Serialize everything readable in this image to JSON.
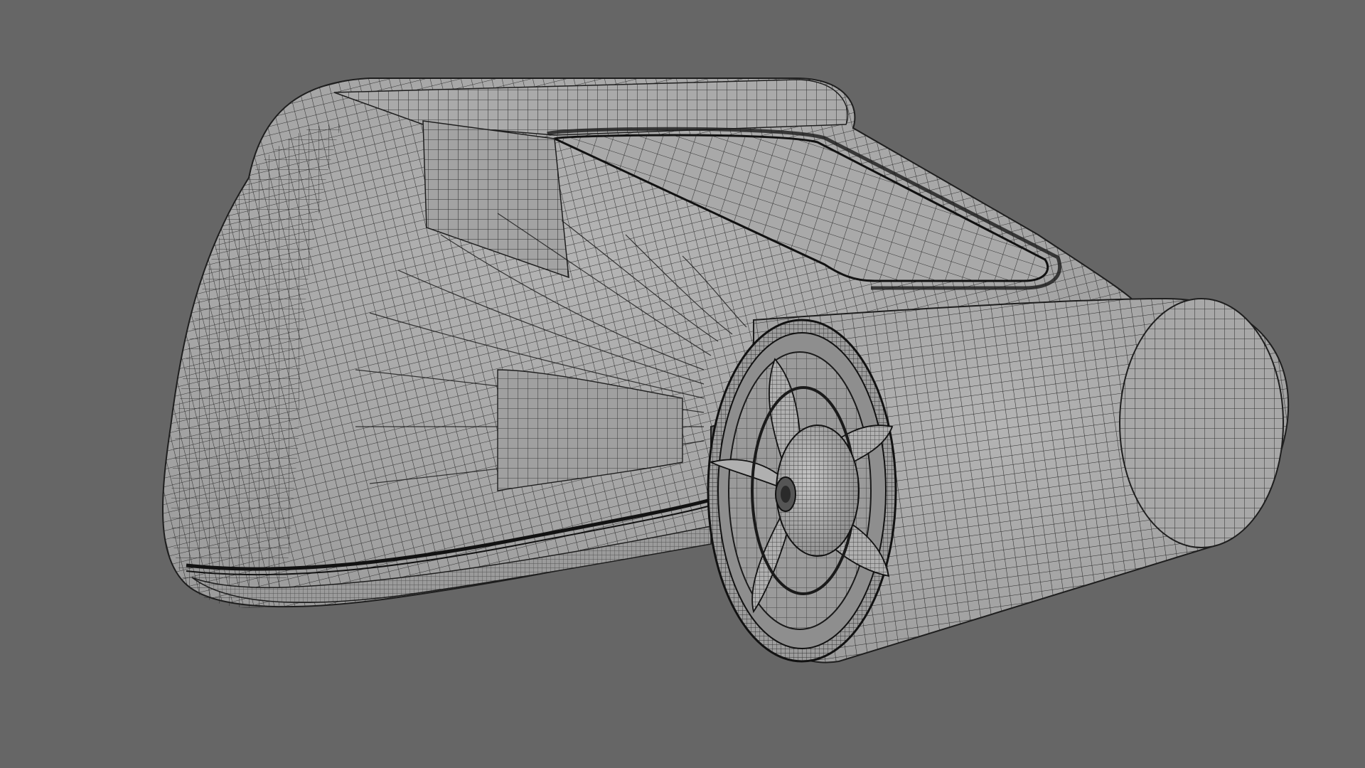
{
  "viewport": {
    "background_color": "#666666",
    "shading": "wireframe-on-shaded",
    "model_surface_color": "#a6a6a6",
    "wire_color": "#1e1e1e"
  }
}
